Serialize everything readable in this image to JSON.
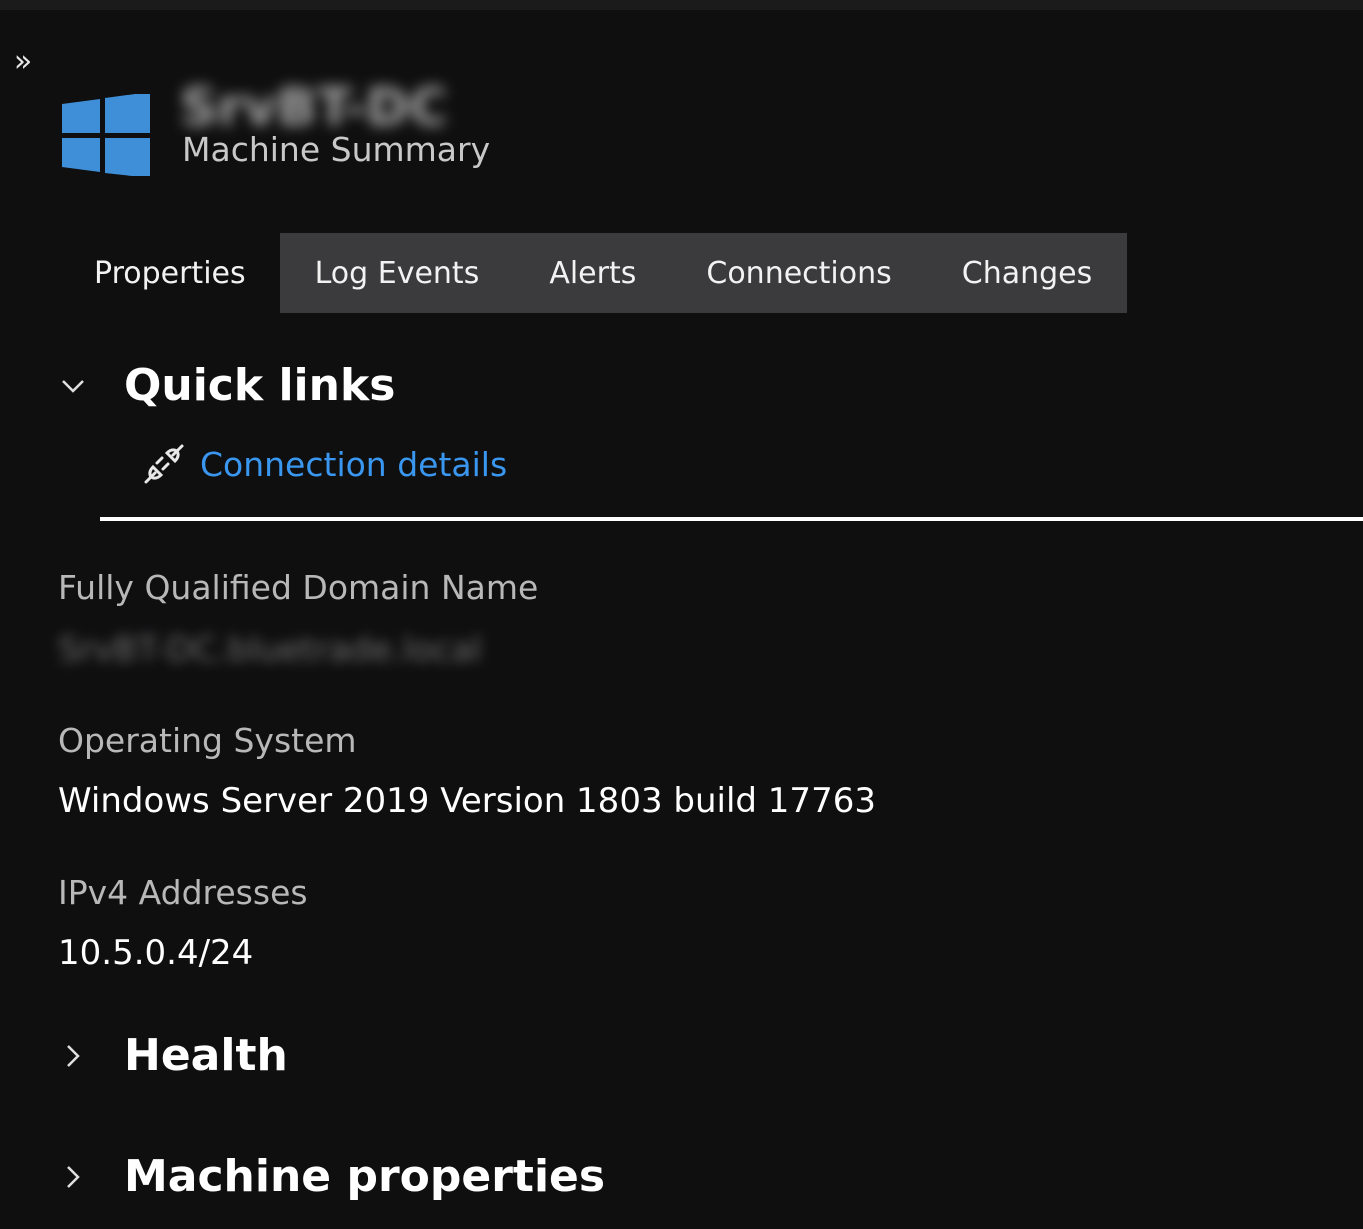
{
  "header": {
    "machine_name": "SrvBT-DC",
    "subtitle": "Machine Summary",
    "logo_icon": "windows-logo",
    "logo_color": "#3f8fd8"
  },
  "tabs": [
    {
      "label": "Properties",
      "active": true
    },
    {
      "label": "Log Events",
      "active": false
    },
    {
      "label": "Alerts",
      "active": false
    },
    {
      "label": "Connections",
      "active": false
    },
    {
      "label": "Changes",
      "active": false
    }
  ],
  "quick_links": {
    "title": "Quick links",
    "expanded": true,
    "items": [
      {
        "label": "Connection details",
        "icon": "plug-icon",
        "color": "#3a97f0"
      }
    ]
  },
  "properties": [
    {
      "label": "Fully Qualified Domain Name",
      "value": "SrvBT-DC.bluetrade.local"
    },
    {
      "label": "Operating System",
      "value": "Windows Server 2019 Version 1803 build 17763"
    },
    {
      "label": "IPv4 Addresses",
      "value": "10.5.0.4/24"
    }
  ],
  "sections": [
    {
      "title": "Health",
      "expanded": false
    },
    {
      "title": "Machine properties",
      "expanded": false
    }
  ],
  "colors": {
    "background": "#0f0f10",
    "tab_group_bg": "#3b3b3d",
    "link": "#3a97f0",
    "label_text": "#b8b8b8"
  }
}
